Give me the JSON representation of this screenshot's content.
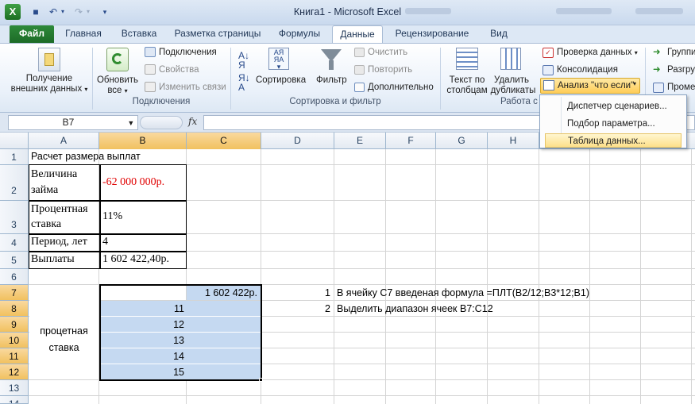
{
  "window": {
    "title": "Книга1  -  Microsoft Excel"
  },
  "tabs": [
    "Файл",
    "Главная",
    "Вставка",
    "Разметка страницы",
    "Формулы",
    "Данные",
    "Рецензирование",
    "Вид"
  ],
  "ribbon": {
    "get_external": {
      "line1": "Получение",
      "line2": "внешних данных"
    },
    "refresh": {
      "line1": "Обновить",
      "line2": "все"
    },
    "connections": "Подключения",
    "properties": "Свойства",
    "edit_links": "Изменить связи",
    "group_connections": "Подключения",
    "sort": "Сортировка",
    "filter": "Фильтр",
    "clear": "Очистить",
    "reapply": "Повторить",
    "advanced": "Дополнительно",
    "group_sort_filter": "Сортировка и фильтр",
    "text_to_columns": {
      "line1": "Текст по",
      "line2": "столбцам"
    },
    "remove_duplicates": {
      "line1": "Удалить",
      "line2": "дубликаты"
    },
    "data_validation": "Проверка данных",
    "consolidate": "Консолидация",
    "what_if": "Анализ \"что если\"",
    "group_data_tools": "Работа с",
    "group": "Группи",
    "ungroup": "Разгру",
    "subtotal": "Проме"
  },
  "menu": {
    "items": [
      "Диспетчер сценариев...",
      "Подбор параметра...",
      "Таблица данных..."
    ]
  },
  "formula_bar": {
    "name_box": "B7",
    "fx": "fx",
    "formula": ""
  },
  "columns": [
    "A",
    "B",
    "C",
    "D",
    "E",
    "F",
    "G",
    "H"
  ],
  "rows": [
    "1",
    "2",
    "3",
    "4",
    "5",
    "6",
    "7",
    "8",
    "9",
    "10",
    "11",
    "12",
    "13",
    "14"
  ],
  "cells": {
    "A1": "Расчет размера выплат",
    "A2a": "Величина",
    "A2b": "займа",
    "B2": "-62 000 000р.",
    "A3a": "Процентная",
    "A3b": "ставка",
    "B3": "11%",
    "A4": "Период, лет",
    "B4": "4",
    "A5": "Выплаты",
    "B5": "1 602 422,40р.",
    "A8a": "процетная",
    "A8b": "ставка",
    "C7": "1 602 422р.",
    "B8": "11",
    "B9": "12",
    "B10": "13",
    "B11": "14",
    "B12": "15",
    "D7": "1",
    "E7": "В ячейку С7 введеная формула =ПЛТ(B2/12;B3*12;B1)",
    "D8": "2",
    "E8": "Выделить диапазон ячеек B7:C12"
  },
  "colors": {
    "negative": "#e00000",
    "selection": "#c5d9f1",
    "file_tab": "#2e8a3a"
  }
}
